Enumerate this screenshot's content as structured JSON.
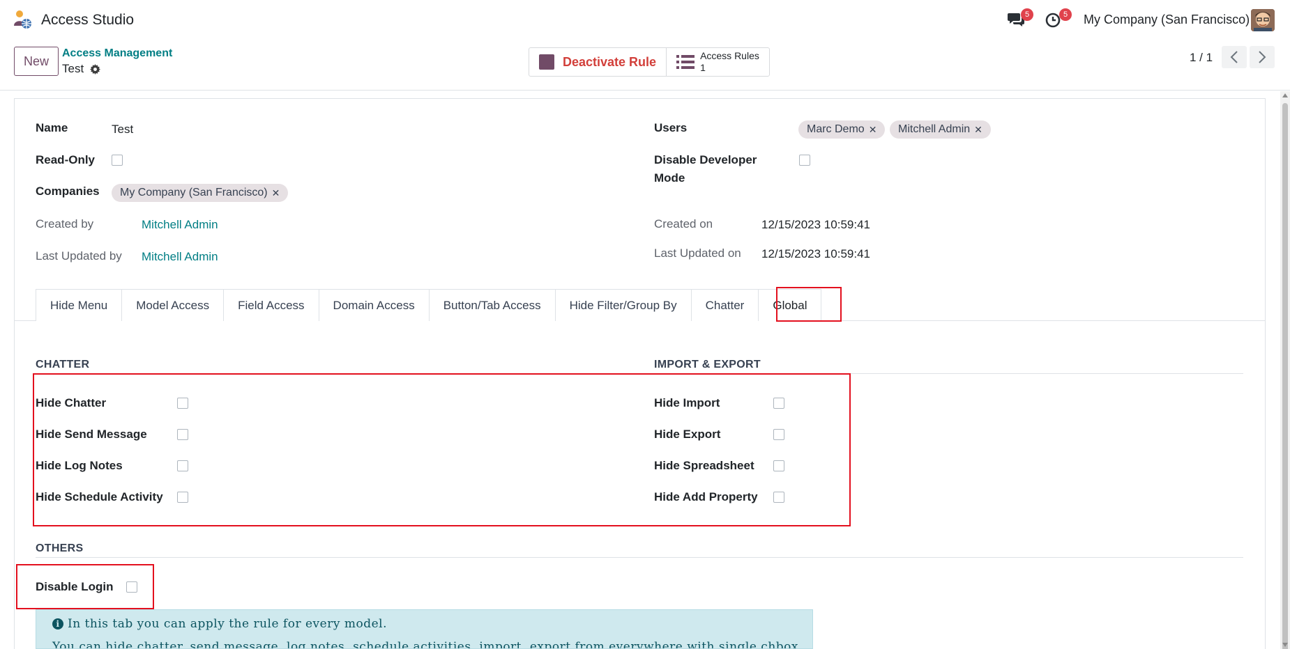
{
  "app": {
    "title": "Access Studio"
  },
  "navbar": {
    "messages_badge": "5",
    "activities_badge": "5",
    "company": "My Company (San Francisco)"
  },
  "control_panel": {
    "new_label": "New",
    "breadcrumb": "Access Management",
    "record_name": "Test",
    "deactivate_label": "Deactivate Rule",
    "access_rules_label": "Access Rules",
    "access_rules_count": "1",
    "pager": "1 / 1"
  },
  "form": {
    "name_label": "Name",
    "name_value": "Test",
    "readonly_label": "Read-Only",
    "companies_label": "Companies",
    "companies_tags": [
      "My Company (San Francisco)"
    ],
    "created_by_label": "Created by",
    "created_by_value": "Mitchell Admin",
    "last_updated_by_label": "Last Updated by",
    "last_updated_by_value": "Mitchell Admin",
    "users_label": "Users",
    "users_tags": [
      "Marc Demo",
      "Mitchell Admin"
    ],
    "disable_dev_label_1": "Disable Developer",
    "disable_dev_label_2": "Mode",
    "created_on_label": "Created on",
    "created_on_value": "12/15/2023 10:59:41",
    "last_updated_on_label": "Last Updated on",
    "last_updated_on_value": "12/15/2023 10:59:41"
  },
  "tabs": [
    "Hide Menu",
    "Model Access",
    "Field Access",
    "Domain Access",
    "Button/Tab Access",
    "Hide Filter/Group By",
    "Chatter",
    "Global"
  ],
  "global": {
    "chatter_title": "CHATTER",
    "chatter_items": [
      "Hide Chatter",
      "Hide Send Message",
      "Hide Log Notes",
      "Hide Schedule Activity"
    ],
    "import_title": "IMPORT & EXPORT",
    "import_items": [
      "Hide Import",
      "Hide Export",
      "Hide Spreadsheet",
      "Hide Add Property"
    ],
    "others_title": "OTHERS",
    "disable_login_label": "Disable Login",
    "info_line1": "In this tab you can apply the rule for every model.",
    "info_line2": "You can hide chatter, send message, log notes, schedule activities, import, export from everywhere with single chbox."
  },
  "colors": {
    "primary": "#714b67",
    "link": "#017e84",
    "danger": "#d23f3a",
    "highlight": "#e3101e",
    "info_bg": "#cfe9ee"
  }
}
